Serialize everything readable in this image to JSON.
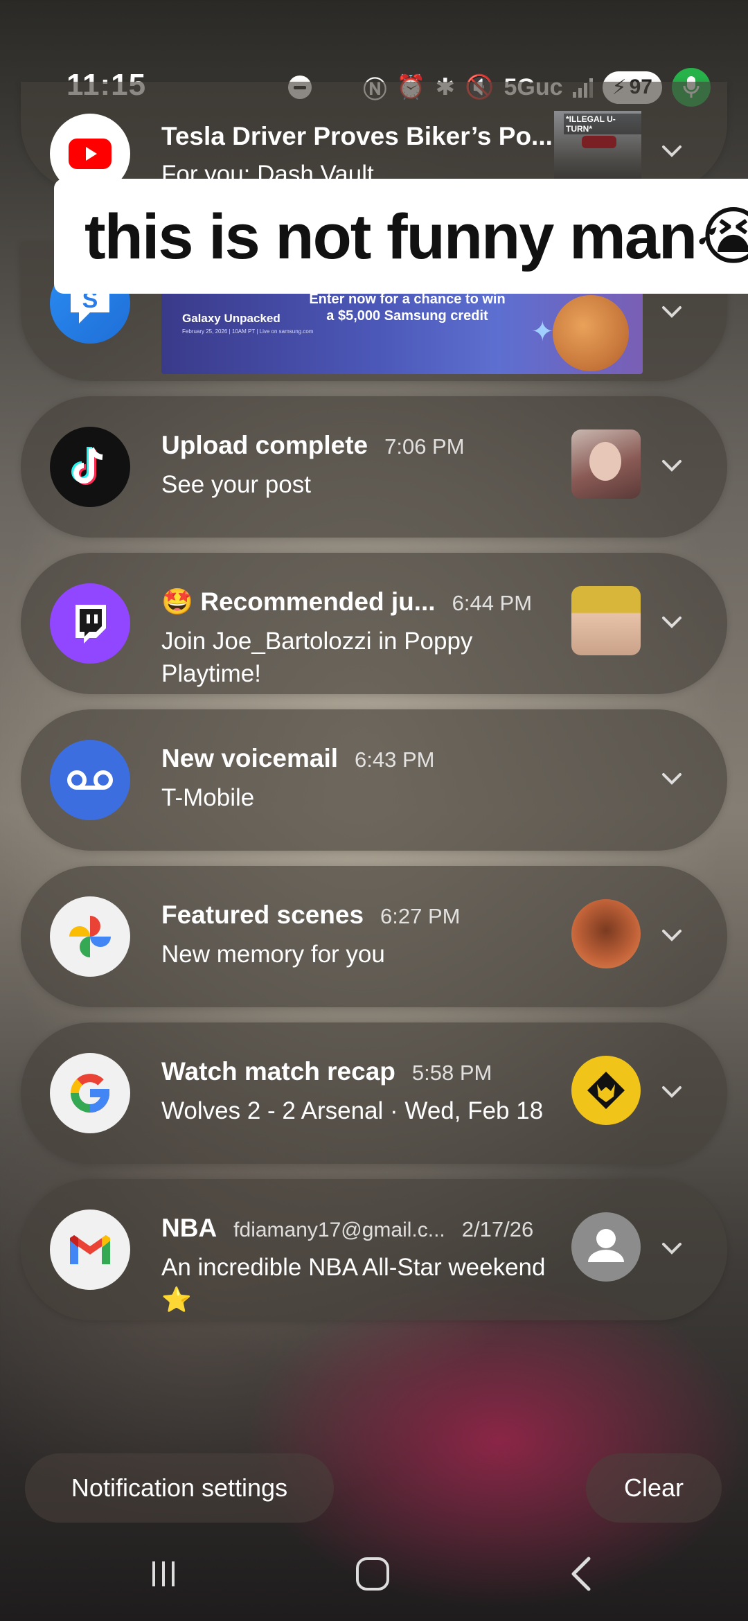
{
  "status_bar": {
    "time": "11:15",
    "network": "5Guc",
    "battery": "97"
  },
  "caption": {
    "text": "this is not funny man😭"
  },
  "notifications": [
    {
      "app": "YouTube",
      "title": "Tesla Driver Proves Biker’s Po...",
      "time": "",
      "body": "For you: Dash Vault",
      "thumb_label": "*ILLEGAL U-TURN*"
    },
    {
      "app": "Samsung Members",
      "title": "",
      "time": "",
      "body": "",
      "banner": {
        "heading": "Galaxy Unpacked",
        "fine_print": "February 25, 2026 | 10AM PT | Live on samsung.com",
        "offer": "Enter now for a chance to win a $5,000 Samsung credit"
      }
    },
    {
      "app": "TikTok",
      "title": "Upload complete",
      "time": "7:06 PM",
      "body": "See your post"
    },
    {
      "app": "Twitch",
      "title": "🤩 Recommended ju...",
      "time": "6:44 PM",
      "body": "Join Joe_Bartolozzi in Poppy Playtime!"
    },
    {
      "app": "Phone",
      "title": "New voicemail",
      "time": "6:43 PM",
      "body": "T-Mobile"
    },
    {
      "app": "Google Photos",
      "title": "Featured scenes",
      "time": "6:27 PM",
      "body": "New memory for you"
    },
    {
      "app": "Google",
      "title": "Watch match recap",
      "time": "5:58 PM",
      "body": "Wolves 2 - 2 Arsenal · Wed, Feb 18"
    },
    {
      "app": "Gmail",
      "title": "NBA",
      "account": "fdiamany17@gmail.c...",
      "time": "2/17/26",
      "body": "An incredible NBA All-Star weekend ⭐"
    }
  ],
  "actions": {
    "settings_label": "Notification settings",
    "clear_label": "Clear"
  },
  "colors": {
    "mic_active": "#27b24a",
    "youtube": "#ff0000",
    "twitch": "#9146ff",
    "voicemail": "#3d6ee0"
  }
}
